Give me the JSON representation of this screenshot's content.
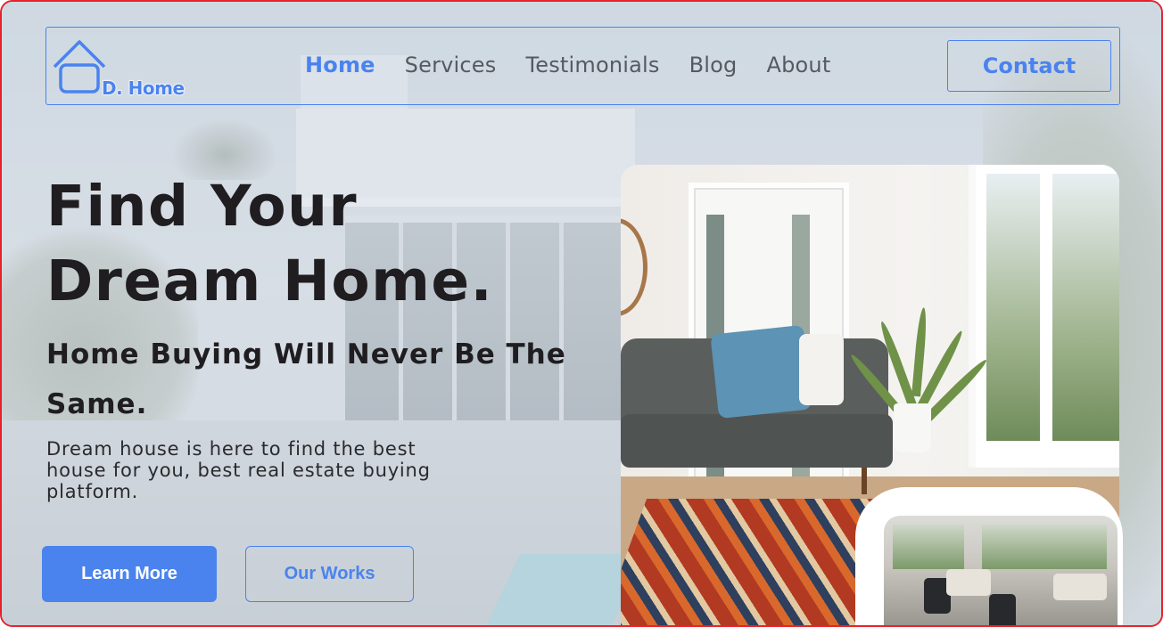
{
  "brand": {
    "logo_text": "D. Home",
    "accent_color": "#4a83ee"
  },
  "nav": {
    "links": [
      {
        "label": "Home",
        "active": true
      },
      {
        "label": "Services",
        "active": false
      },
      {
        "label": "Testimonials",
        "active": false
      },
      {
        "label": "Blog",
        "active": false
      },
      {
        "label": "About",
        "active": false
      }
    ],
    "contact_label": "Contact"
  },
  "hero": {
    "title_line1": "Find Your",
    "title_line2": "Dream Home.",
    "subtitle_line1": "Home Buying Will Never Be The",
    "subtitle_line2": "Same.",
    "description_line1": "Dream house is here to find the best",
    "description_line2": "house for you, best real estate buying",
    "description_line3": "platform.",
    "primary_button": "Learn More",
    "secondary_button": "Our Works"
  },
  "images": {
    "background": "house-exterior-image",
    "main": "living-room-image",
    "secondary": "lounge-interior-image"
  }
}
